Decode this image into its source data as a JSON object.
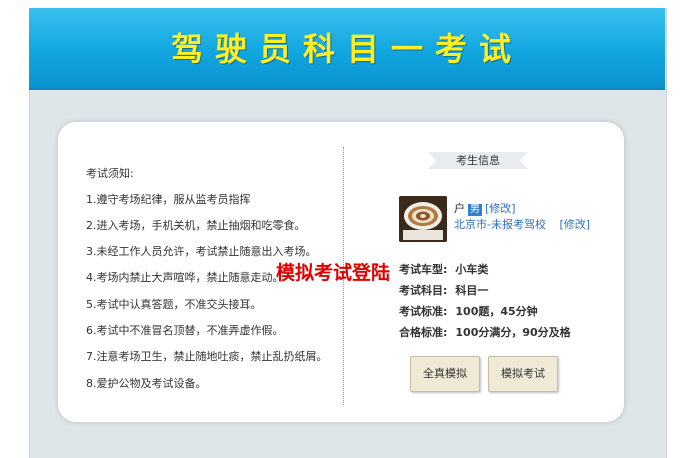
{
  "header": {
    "title": "驾驶员科目一考试"
  },
  "rules": {
    "title": "考试须知:",
    "items": [
      "1.遵守考场纪律，服从监考员指挥",
      "2.进入考场，手机关机，禁止抽烟和吃零食。",
      "3.未经工作人员允许，考试禁止随意出入考场。",
      "4.考场内禁止大声喧哗，禁止随意走动。",
      "5.考试中认真答题，不准交头接耳。",
      "6.考试中不准冒名顶替，不准弄虚作假。",
      "7.注意考场卫生，禁止随地吐痰，禁止乱扔纸屑。",
      "8.爱护公物及考试设备。"
    ]
  },
  "student_info": {
    "title": "考生信息",
    "name": "户",
    "gender": "男",
    "edit_name": "[修改]",
    "school": "北京市-未报考驾校",
    "edit_school": "[修改]"
  },
  "watermark": "模拟考试登陆",
  "exam": {
    "car_type_label": "考试车型:",
    "car_type_value": "小车类",
    "subject_label": "考试科目:",
    "subject_value": "科目一",
    "standard_label": "考试标准:",
    "standard_value": "100题，45分钟",
    "pass_label": "合格标准:",
    "pass_value": "100分满分，90分及格"
  },
  "buttons": {
    "full_sim": "全真模拟",
    "mock_exam": "模拟考试"
  },
  "colors": {
    "header_bg": "#11a6e0",
    "title_text": "#ffee22",
    "watermark": "#e00000",
    "link": "#2f6fbf"
  }
}
